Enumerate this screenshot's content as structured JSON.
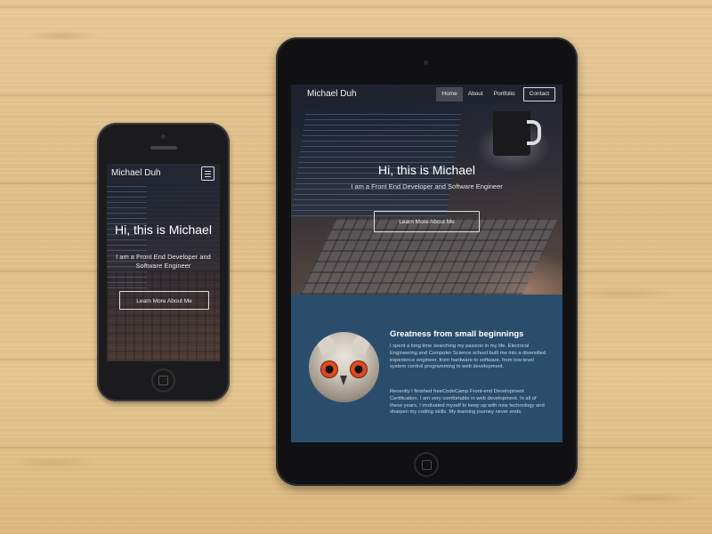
{
  "phone": {
    "brand": "Michael Duh",
    "hero_title": "Hi, this is Michael",
    "hero_subtitle": "I am a Front End Developer and Software Engineer",
    "cta_label": "Learn More About Me"
  },
  "tablet": {
    "brand": "Michael Duh",
    "nav": [
      {
        "label": "Home"
      },
      {
        "label": "About"
      },
      {
        "label": "Portfolio"
      },
      {
        "label": "Contact"
      }
    ],
    "hero_title": "Hi, this is Michael",
    "hero_subtitle": "I am a Front End Developer and Software Engineer",
    "cta_label": "Learn More About Me",
    "about": {
      "heading": "Greatness from small beginnings",
      "paragraph1": "I spent a long time searching my passion in my life. Electrical Engineering and Computer Science school built me into a diversified experience engineer, from hardware to software, from low-level system control programming to web development.",
      "paragraph2": "Recently I finished freeCodeCamp Front-end Development Certification. I am very comfortable in web development. In all of these years, I motivated myself to keep up with new technology and sharpen my coding skills. My learning journey never ends."
    }
  },
  "colors": {
    "about_bg": "#2a4d6c",
    "device_body": "#111113"
  }
}
